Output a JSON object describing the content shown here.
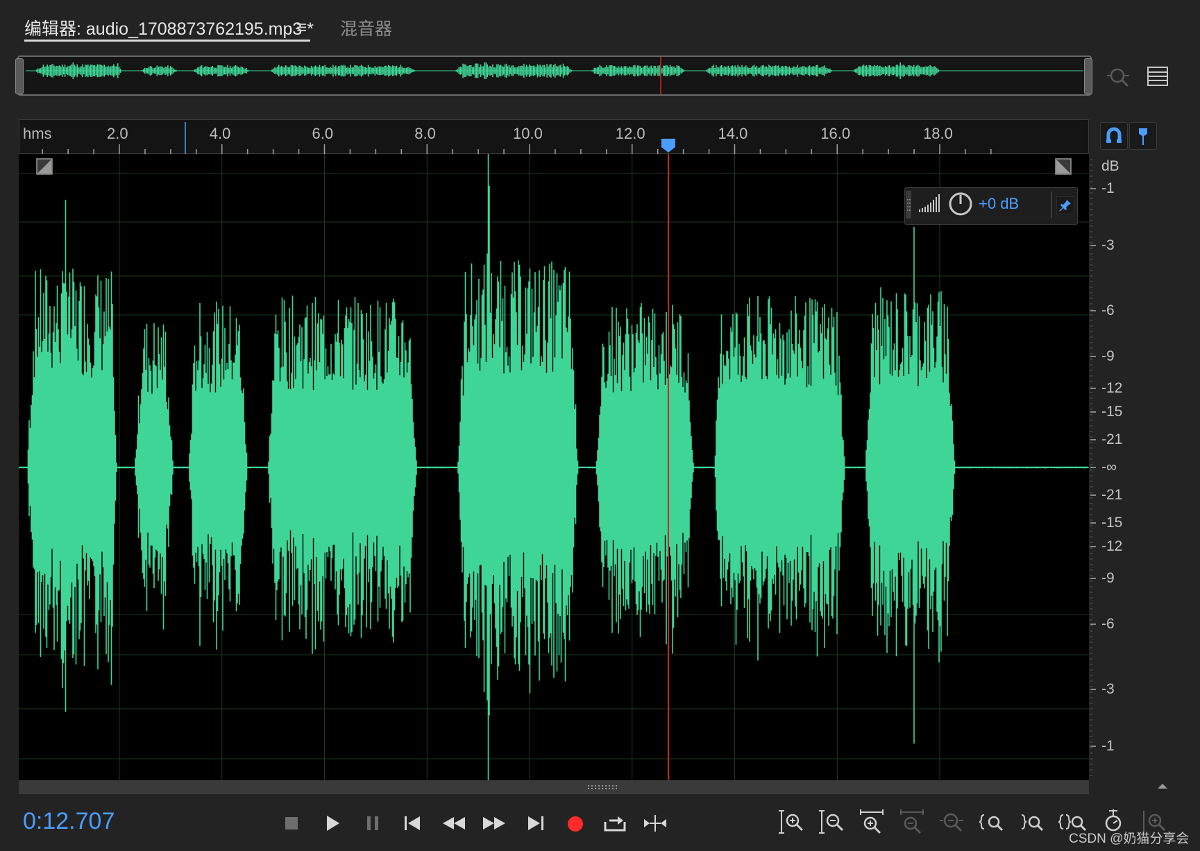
{
  "tabs": {
    "editor_label": "编辑器: audio_1708873762195.mp3 *",
    "menu_glyph": "≡",
    "mixer_label": "混音器"
  },
  "ruler": {
    "unit": "hms",
    "labels": [
      "2.0",
      "4.0",
      "6.0",
      "8.0",
      "10.0",
      "12.0",
      "14.0",
      "16.0",
      "18.0"
    ]
  },
  "hud": {
    "gain": "+0 dB"
  },
  "db_scale": {
    "unit": "dB",
    "top_labels": [
      "-1",
      "-3",
      "-6",
      "-9",
      "-12",
      "-15",
      "-21"
    ],
    "center_label": "-∞",
    "bottom_labels": [
      "-21",
      "-15",
      "-12",
      "-9",
      "-6",
      "-3",
      "-1"
    ]
  },
  "transport": {
    "timecode": "0:12.707",
    "playhead_seconds": 12.707
  },
  "colors": {
    "waveform": "#3fd596",
    "playhead": "#d42020",
    "accent": "#4a9eff",
    "record": "#ff2a2a"
  },
  "icons": [
    "stop-icon",
    "play-icon",
    "pause-icon",
    "skip-to-start-icon",
    "rewind-icon",
    "fast-forward-icon",
    "skip-to-end-icon",
    "record-icon",
    "loop-icon",
    "skip-selection-icon",
    "zoom-in-amplitude-icon",
    "zoom-out-amplitude-icon",
    "zoom-in-time-icon",
    "zoom-out-time-icon",
    "zoom-out-full-icon",
    "zoom-in-selection-start-icon",
    "zoom-in-selection-end-icon",
    "zoom-to-selection-icon",
    "zoom-in-cursor-icon",
    "zoom-track-icon"
  ],
  "watermark": "CSDN @奶猫分享会"
}
